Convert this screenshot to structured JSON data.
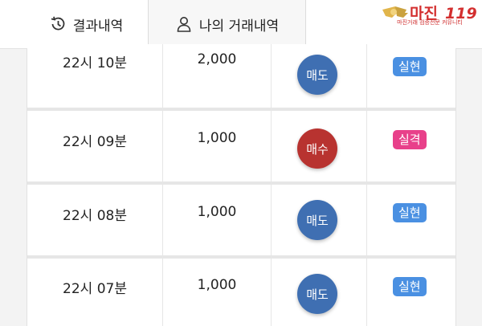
{
  "tabs": [
    {
      "label": "결과내역",
      "icon": "history-icon"
    },
    {
      "label": "나의 거래내역",
      "icon": "user-icon"
    }
  ],
  "logo": {
    "brand": "마진",
    "number": "119",
    "tagline": "마진거래 검증전문 커뮤니티"
  },
  "colors": {
    "sell": "#3f6fb2",
    "buy": "#b83330",
    "success": "#4a90e2",
    "fail": "#e8408a"
  },
  "rows": [
    {
      "time": "22시 10분",
      "amount": "2,000",
      "side": "매도",
      "side_type": "sell",
      "result": "실현",
      "result_type": "success"
    },
    {
      "time": "22시 09분",
      "amount": "1,000",
      "side": "매수",
      "side_type": "buy",
      "result": "실격",
      "result_type": "fail"
    },
    {
      "time": "22시 08분",
      "amount": "1,000",
      "side": "매도",
      "side_type": "sell",
      "result": "실현",
      "result_type": "success"
    },
    {
      "time": "22시 07분",
      "amount": "1,000",
      "side": "매도",
      "side_type": "sell",
      "result": "실현",
      "result_type": "success"
    }
  ]
}
